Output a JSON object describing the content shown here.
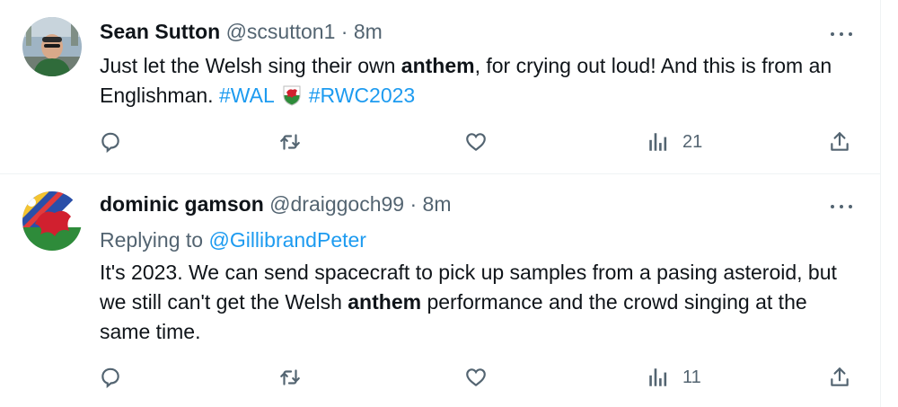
{
  "tweets": [
    {
      "name": "Sean Sutton",
      "handle": "@scsutton1",
      "separator": "·",
      "time": "8m",
      "text_parts": [
        "Just let the Welsh sing their own ",
        "anthem",
        ", for crying out loud! And this is from an Englishman."
      ],
      "hashtags": [
        "#WAL",
        "#RWC2023"
      ],
      "views": "21",
      "icons": [
        "reply-icon",
        "retweet-icon",
        "like-icon",
        "views-icon",
        "share-icon",
        "more-icon",
        "welsh-flag-icon"
      ]
    },
    {
      "name": "dominic gamson",
      "handle": "@draiggoch99",
      "separator": "·",
      "time": "8m",
      "replying_label": "Replying to",
      "replying_to": "@GillibrandPeter",
      "text_parts": [
        "It's 2023. We can send spacecraft to pick up samples from a pasing asteroid, but we still can't get the Welsh ",
        "anthem",
        " performance and the crowd singing at the same time."
      ],
      "views": "11",
      "icons": [
        "reply-icon",
        "retweet-icon",
        "like-icon",
        "views-icon",
        "share-icon",
        "more-icon"
      ]
    }
  ],
  "colors": {
    "text": "#0f1419",
    "muted": "#536471",
    "link": "#1d9bf0",
    "divider": "#eff3f4"
  }
}
